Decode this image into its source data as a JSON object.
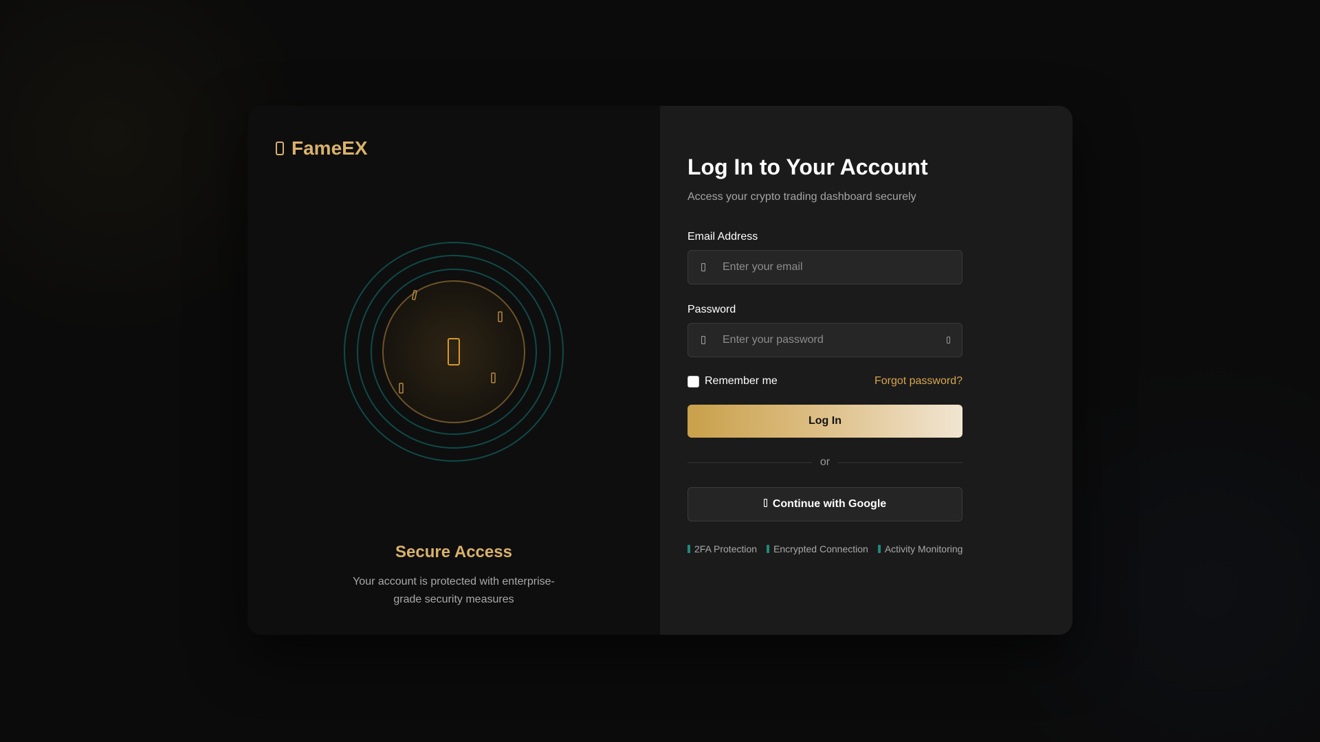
{
  "brand": {
    "name": "FameEX"
  },
  "hero": {
    "title": "Secure Access",
    "description": "Your account is protected with enterprise-grade security measures"
  },
  "form": {
    "title": "Log In to Your Account",
    "subtitle": "Access your crypto trading dashboard securely",
    "email": {
      "label": "Email Address",
      "placeholder": "Enter your email",
      "value": ""
    },
    "password": {
      "label": "Password",
      "placeholder": "Enter your password",
      "value": ""
    },
    "remember_label": "Remember me",
    "forgot_label": "Forgot password?",
    "login_label": "Log In",
    "divider_label": "or",
    "google_label": "Continue with Google"
  },
  "features": [
    {
      "label": "2FA Protection",
      "icon": "shield-icon"
    },
    {
      "label": "Encrypted Connection",
      "icon": "lock-icon"
    },
    {
      "label": "Activity Monitoring",
      "icon": "eye-icon"
    }
  ],
  "colors": {
    "accent_gold": "#d9b26a",
    "accent_teal": "#1f8a7a",
    "panel_left": "#0e0e0e",
    "panel_right": "#1b1b1b"
  }
}
